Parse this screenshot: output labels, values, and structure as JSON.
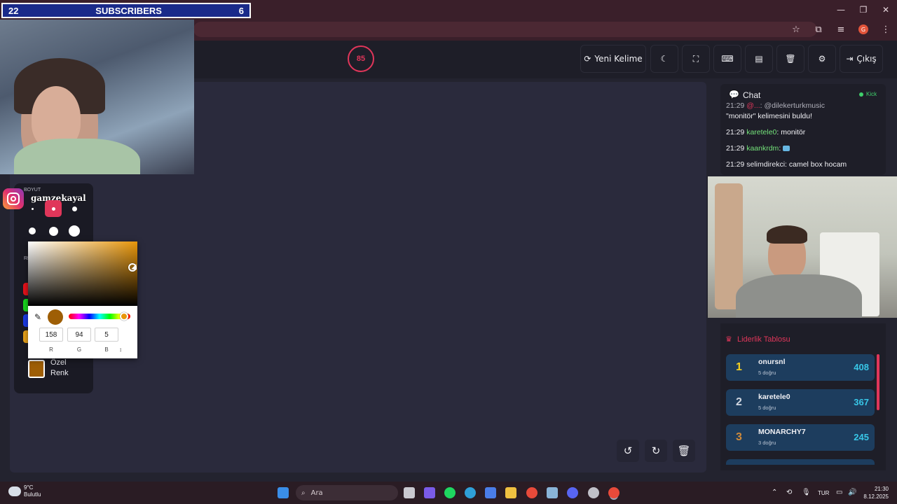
{
  "window_controls": {
    "minimize": "—",
    "restore": "❐",
    "close": "✕"
  },
  "browser": {
    "profile_initial": "G"
  },
  "subscribers": {
    "left_count": "22",
    "label": "SUBSCRIBERS",
    "right_count": "6"
  },
  "header": {
    "timer": "85",
    "new_word_label": "Yeni Kelime",
    "logout_label": "Çıkış"
  },
  "instagram": {
    "handle": "gamzekayal"
  },
  "tool_panel": {
    "size_label": "BOYUT",
    "colors_label": "RE",
    "custom_color_line1": "Özel",
    "custom_color_line2": "Renk"
  },
  "color_picker": {
    "r": "158",
    "g": "94",
    "b": "5",
    "r_label": "R",
    "g_label": "G",
    "b_label": "B",
    "mode_toggle": "↕",
    "current_color": "#9e5e05"
  },
  "chat": {
    "title": "Chat",
    "source": "Kick",
    "messages": [
      {
        "time": "21:29",
        "user": "@...",
        "text": ": @dilekerturkmusic"
      },
      {
        "time": "",
        "user": "",
        "text": "\"monitör\" kelimesini buldu!"
      },
      {
        "time": "21:29",
        "user": "karetele0",
        "text": ": monitör"
      },
      {
        "time": "21:29",
        "user": "kaankrdm",
        "text": ":"
      },
      {
        "time": "21:29",
        "user": "selimdirekci",
        "text": ": camel box hocam"
      }
    ]
  },
  "leaderboard": {
    "title": "Liderlik Tablosu",
    "rows": [
      {
        "rank": "1",
        "name": "onursnl",
        "sub": "5 doğru",
        "score": "408",
        "rank_color": "#f5d020"
      },
      {
        "rank": "2",
        "name": "karetele0",
        "sub": "5 doğru",
        "score": "367",
        "rank_color": "#d0d6e0"
      },
      {
        "rank": "3",
        "name": "MONARCHY7",
        "sub": "3 doğru",
        "score": "245",
        "rank_color": "#d08a3a"
      }
    ]
  },
  "taskbar": {
    "weather_temp": "9°C",
    "weather_desc": "Bulutlu",
    "search_placeholder": "Ara",
    "language": "TUR",
    "time": "21:30",
    "date": "8.12.2025"
  },
  "colors": {
    "accent": "#e0365a",
    "score": "#38c7e8",
    "chat_user": "#74e27a",
    "kick": "#3fcf6b"
  }
}
